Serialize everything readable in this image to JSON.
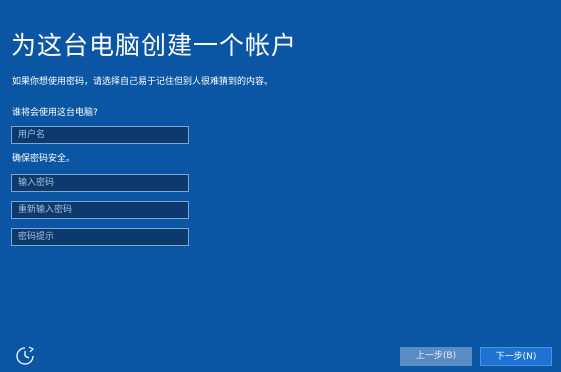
{
  "page": {
    "title": "为这台电脑创建一个帐户",
    "subtitle": "如果你想使用密码，请选择自己易于记住但别人很难猜到的内容。"
  },
  "who_section": {
    "label": "谁将会使用这台电脑?",
    "username_placeholder": "用户名",
    "username_value": ""
  },
  "security_section": {
    "label": "确保密码安全。",
    "password_placeholder": "输入密码",
    "reenter_placeholder": "重新输入密码",
    "hint_placeholder": "密码提示"
  },
  "footer": {
    "ease_of_access_icon": "ease-of-access-icon",
    "back_label": "上一步(B)",
    "next_label": "下一步(N)"
  },
  "colors": {
    "background": "#0b56a4",
    "field_background": "#0d3a6e",
    "field_border": "#7fa6d1",
    "back_button": "#5a8cc4",
    "next_button": "#1e73d2"
  }
}
